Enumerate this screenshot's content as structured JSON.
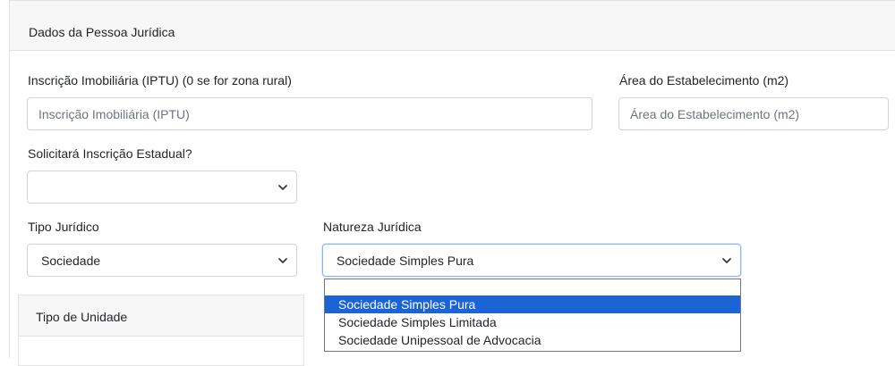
{
  "panel": {
    "title": "Dados da Pessoa Jurídica"
  },
  "fields": {
    "iptu": {
      "label": "Inscrição Imobiliária (IPTU) (0 se for zona rural)",
      "placeholder": "Inscrição Imobiliária (IPTU)",
      "value": ""
    },
    "area": {
      "label": "Área do Estabelecimento (m2)",
      "placeholder": "Área do Estabelecimento (m2)",
      "value": ""
    },
    "inscricao_estadual": {
      "label": "Solicitará Inscrição Estadual?",
      "value": ""
    },
    "tipo_juridico": {
      "label": "Tipo Jurídico",
      "value": "Sociedade"
    },
    "natureza_juridica": {
      "label": "Natureza Jurídica",
      "value": "Sociedade Simples Pura",
      "options": [
        "",
        "Sociedade Simples Pura",
        "Sociedade Simples Limitada",
        "Sociedade Unipessoal de Advocacia"
      ],
      "highlighted_option": "Sociedade Simples Pura"
    }
  },
  "tipo_unidade": {
    "title": "Tipo de Unidade"
  },
  "icons": {
    "select_arrow": "chevron-down-icon"
  },
  "colors": {
    "highlight": "#1a64d6",
    "focus_border": "#86b7fe",
    "header_bg": "#f7f7f7"
  }
}
